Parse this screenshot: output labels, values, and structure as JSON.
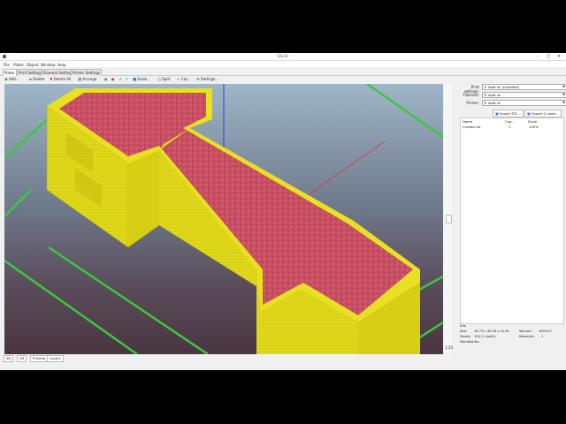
{
  "window": {
    "title": "Slic3r"
  },
  "menu": [
    "File",
    "Plater",
    "Object",
    "Window",
    "Help"
  ],
  "tabs": [
    "Plater",
    "Print Settings",
    "Filament Settings",
    "Printer Settings"
  ],
  "toolbar": {
    "add": "Add...",
    "delete": "Delete",
    "delete_all": "Delete All",
    "arrange": "Arrange",
    "scale": "Scale...",
    "split": "Split",
    "cut": "Cut...",
    "settings": "Settings..."
  },
  "viewport": {
    "zoom_label": "1:35"
  },
  "bottom_tabs": [
    "3D",
    "2D",
    "Preview",
    "Layers"
  ],
  "settings": {
    "print_label": "Print settings:",
    "print_value": "debt ini (modified)",
    "filament_label": "Filament:",
    "filament_value": "debt ini",
    "printer_label": "Printer:",
    "printer_value": "debt ini"
  },
  "export": {
    "stl": "Export STL...",
    "gcode": "Export G-code..."
  },
  "object_list": {
    "headers": [
      "Name",
      "Cop...",
      "Scale"
    ],
    "rows": [
      {
        "name": "Creeper.stl",
        "copies": "1",
        "scale": "100%"
      }
    ]
  },
  "info": {
    "title": "Info",
    "size_label": "Size:",
    "size_value": "16.73 x 40.06 x 14.40",
    "volume_label": "Volume:",
    "volume_value": "1625.47",
    "facets_label": "Facets:",
    "facets_value": "104 (1 shells)",
    "materials_label": "Materials:",
    "materials_value": "1",
    "manifold_label": "Manifold:",
    "manifold_value": "Yes"
  },
  "colors": {
    "infill": "#d2566a",
    "wall": "#e4dc1a",
    "grid": "#3cc83c"
  }
}
